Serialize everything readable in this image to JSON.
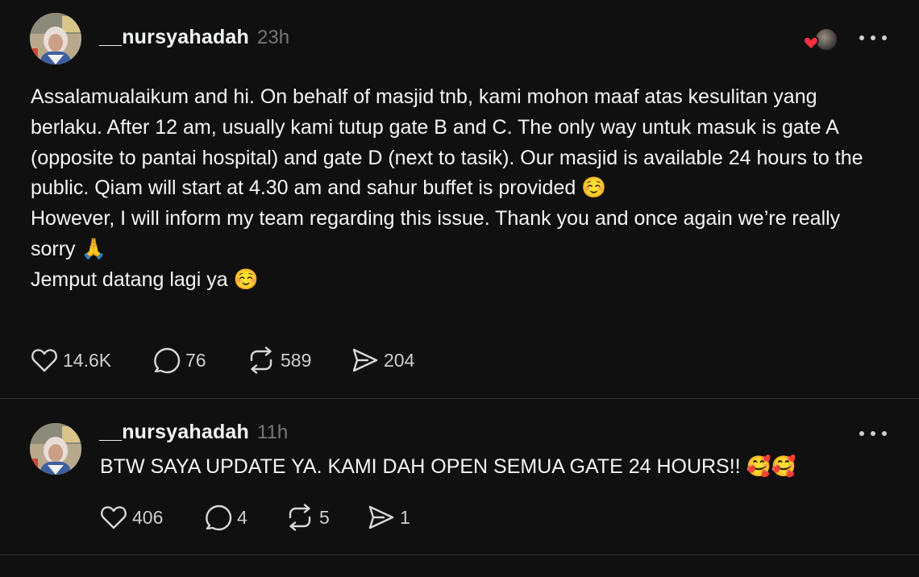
{
  "posts": [
    {
      "username": "__nursyahadah",
      "timestamp": "23h",
      "body": "Assalamualaikum and hi. On behalf of masjid tnb, kami mohon maaf atas kesulitan yang berlaku. After 12 am, usually kami tutup gate B and C. The only way untuk masuk is gate A (opposite to pantai hospital) and gate D (next to tasik). Our masjid is available 24 hours to the public. Qiam will start at 4.30 am and sahur buffet is provided ☺️\nHowever, I will inform my team regarding this issue. Thank you and once again we’re really sorry 🙏\nJemput datang lagi ya ☺️",
      "likes": "14.6K",
      "replies": "76",
      "reposts": "589",
      "shares": "204",
      "liked_by_icon": "heart-icon"
    },
    {
      "username": "__nursyahadah",
      "timestamp": "11h",
      "body": "BTW SAYA UPDATE YA. KAMI DAH OPEN SEMUA GATE 24 HOURS!! 🥰🥰",
      "likes": "406",
      "replies": "4",
      "reposts": "5",
      "shares": "1"
    }
  ],
  "colors": {
    "background": "#101010",
    "text": "#f3f5f7",
    "muted": "#777777",
    "divider": "#2d2d2d",
    "heart": "#ff3040"
  }
}
